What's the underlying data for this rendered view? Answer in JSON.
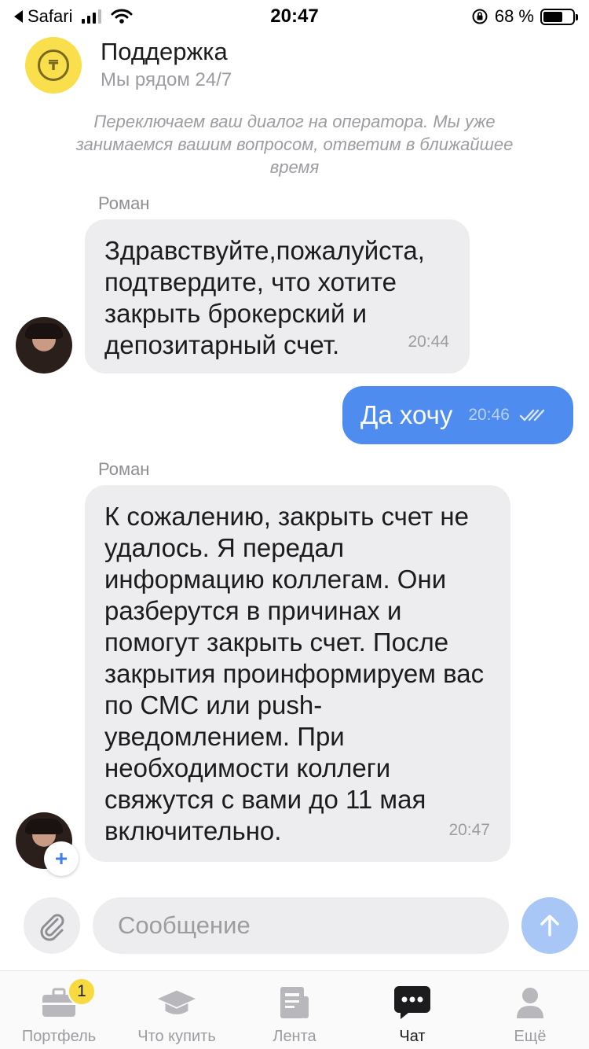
{
  "status_bar": {
    "back_app": "Safari",
    "time": "20:47",
    "battery_percent": "68 %"
  },
  "header": {
    "title": "Поддержка",
    "subtitle": "Мы рядом 24/7",
    "logo_icon": "tinkoff-logo-icon"
  },
  "system_note": "Переключаем ваш диалог на оператора. Мы уже занимаемся вашим вопросом, ответим в ближайшее время",
  "messages": [
    {
      "sender": "Роман",
      "text": "Здравствуйте,пожалуйста, подтвердите, что хотите закрыть брокерский и депозитарный счет.",
      "time": "20:44"
    },
    {
      "text": "Да хочу",
      "time": "20:46"
    },
    {
      "sender": "Роман",
      "text": "К сожалению, закрыть счет не удалось. Я передал информацию коллегам. Они разберутся в причинах и помогут закрыть счет. После закрытия проинформируем вас по СМС или push-уведомлением. При необходимости коллеги свяжутся с вами до 11 мая включительно.",
      "time": "20:47"
    }
  ],
  "composer": {
    "placeholder": "Сообщение",
    "value": ""
  },
  "tabs": [
    {
      "label": "Портфель",
      "icon": "briefcase-icon",
      "badge": "1"
    },
    {
      "label": "Что купить",
      "icon": "graduation-cap-icon"
    },
    {
      "label": "Лента",
      "icon": "newspaper-icon"
    },
    {
      "label": "Чат",
      "icon": "chat-icon",
      "active": true
    },
    {
      "label": "Ещё",
      "icon": "profile-icon"
    }
  ],
  "colors": {
    "accent_blue": "#4e8def",
    "send_button": "#a8c6f6",
    "brand_yellow": "#f8df4b",
    "incoming_bubble": "#ededf0"
  }
}
